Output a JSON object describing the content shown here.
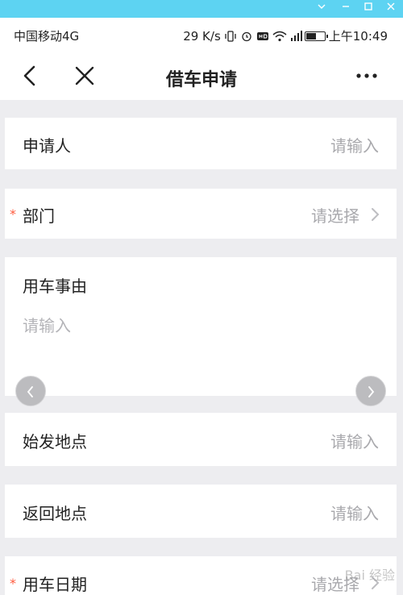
{
  "status_bar": {
    "carrier": "中国移动4G",
    "speed": "29 K/s",
    "time": "上午10:49",
    "battery_level": 0.55
  },
  "nav": {
    "title": "借车申请"
  },
  "form": {
    "applicant": {
      "label": "申请人",
      "placeholder": "请输入"
    },
    "department": {
      "label": "部门",
      "placeholder": "请选择",
      "required_mark": "*"
    },
    "reason": {
      "label": "用车事由",
      "placeholder": "请输入"
    },
    "departure": {
      "label": "始发地点",
      "placeholder": "请输入"
    },
    "return_place": {
      "label": "返回地点",
      "placeholder": "请输入"
    },
    "date": {
      "label": "用车日期",
      "placeholder": "请选择",
      "required_mark": "*"
    }
  },
  "watermark": "Bai 经验",
  "colors": {
    "window_bar": "#5dd3f2",
    "required": "#ff5a3c",
    "placeholder": "#a9a9ad"
  }
}
